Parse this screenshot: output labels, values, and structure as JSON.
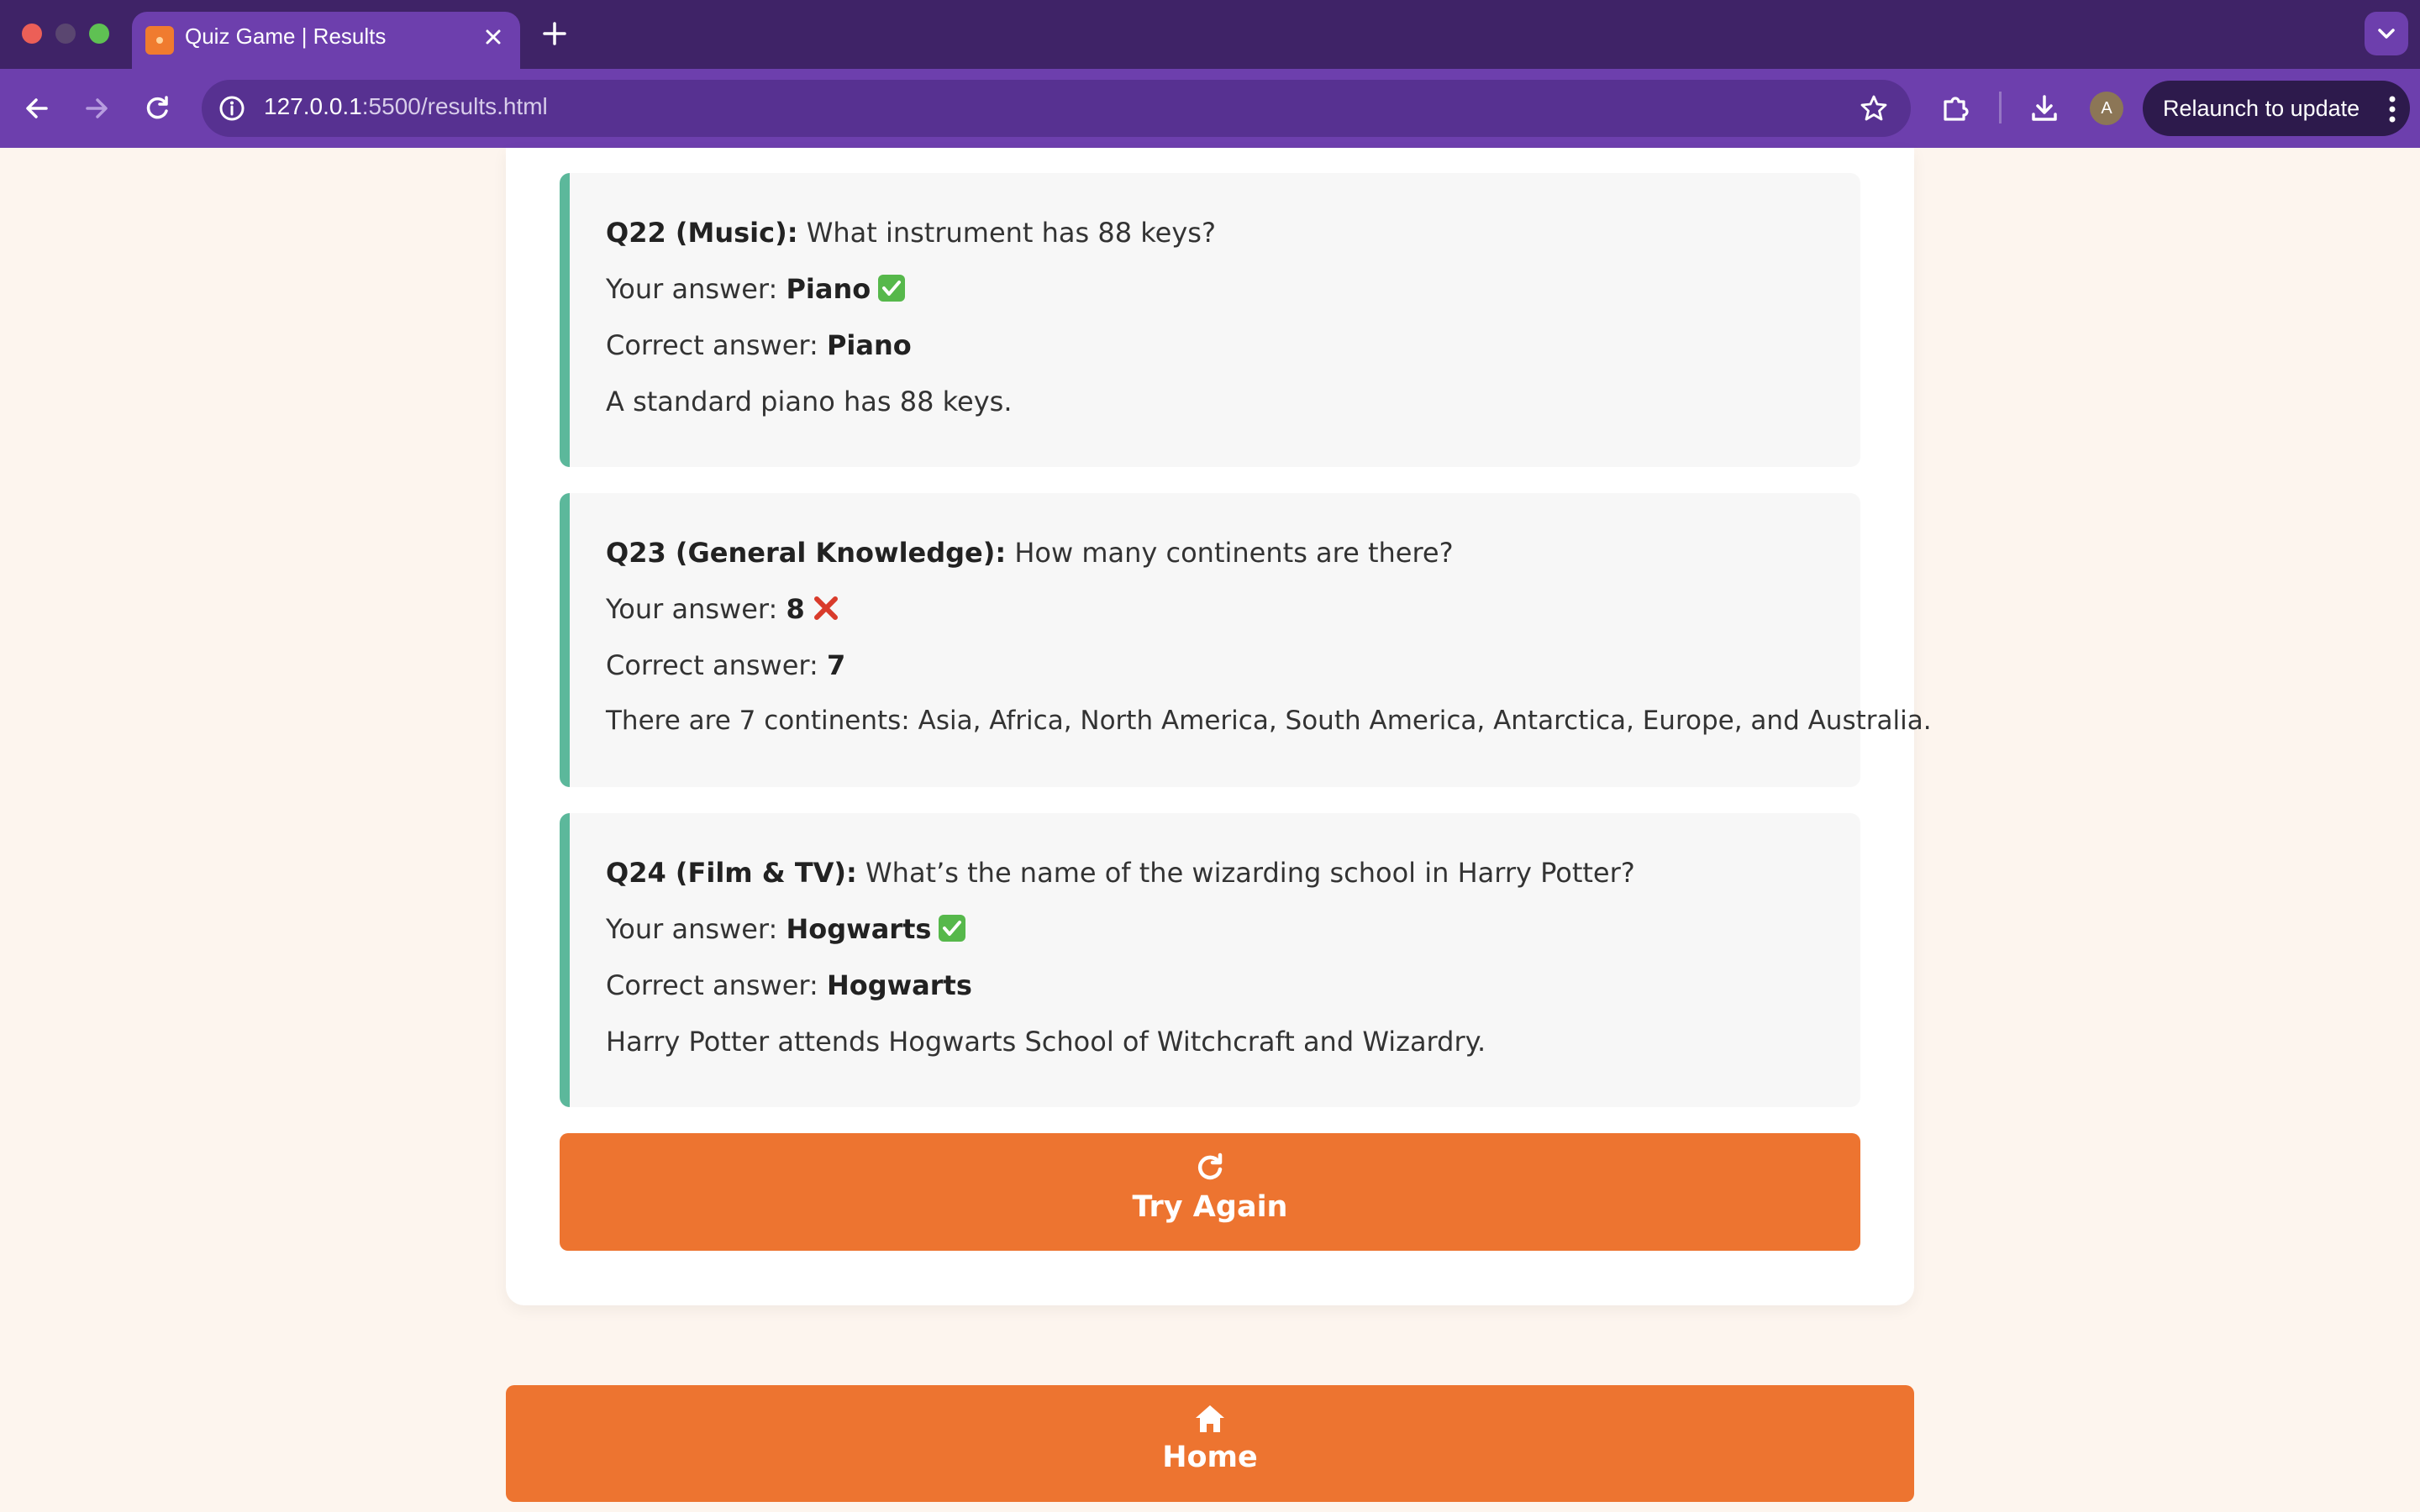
{
  "browser": {
    "tab": {
      "title": "Quiz Game | Results"
    },
    "url": {
      "host": "127.0.0.1",
      "rest": ":5500/results.html"
    },
    "relaunch_label": "Relaunch to update",
    "avatar_initial": "A",
    "icons": {
      "back": "arrow-left-icon",
      "forward": "arrow-right-icon",
      "reload": "reload-icon",
      "site_info": "info-icon",
      "bookmark": "star-icon",
      "extensions": "puzzle-icon",
      "downloads": "download-icon",
      "menu": "kebab-menu-icon"
    },
    "colors": {
      "frame": "#3f2367",
      "toolbar": "#6d3fad"
    }
  },
  "results": {
    "accent_color": "#5cb89b",
    "button_color": "#ed7430",
    "questions": [
      {
        "heading": "Q22 (Music):",
        "question": "What instrument has 88 keys?",
        "your_answer_label": "Your answer:",
        "your_answer": "Piano",
        "status_icon": "check-icon",
        "correct_answer_label": "Correct answer:",
        "correct_answer": "Piano",
        "explanation": "A standard piano has 88 keys."
      },
      {
        "heading": "Q23 (General Knowledge):",
        "question": "How many continents are there?",
        "your_answer_label": "Your answer:",
        "your_answer": "8",
        "status_icon": "cross-icon",
        "correct_answer_label": "Correct answer:",
        "correct_answer": "7",
        "explanation": "There are 7 continents: Asia, Africa, North America, South America, Antarctica, Europe, and Australia."
      },
      {
        "heading": "Q24 (Film & TV):",
        "question": "What’s the name of the wizarding school in Harry Potter?",
        "your_answer_label": "Your answer:",
        "your_answer": "Hogwarts",
        "status_icon": "check-icon",
        "correct_answer_label": "Correct answer:",
        "correct_answer": "Hogwarts",
        "explanation": "Harry Potter attends Hogwarts School of Witchcraft and Wizardry."
      }
    ],
    "try_again_label": "Try Again",
    "try_again_icon": "refresh-icon",
    "home_label": "Home",
    "home_icon": "home-icon"
  }
}
